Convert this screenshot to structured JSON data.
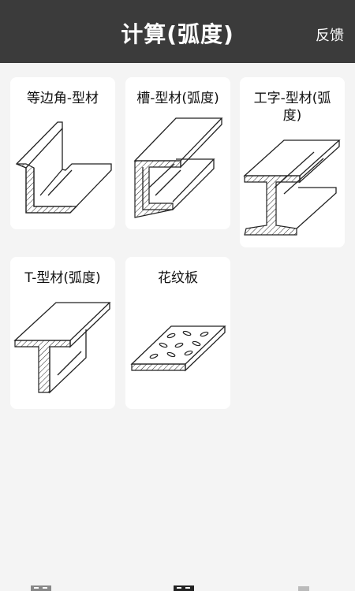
{
  "header": {
    "title": "计算(弧度)",
    "feedback": "反馈"
  },
  "cards": [
    {
      "label": "等边角-型材",
      "icon": "angle-steel-icon"
    },
    {
      "label": "槽-型材(弧度)",
      "icon": "channel-steel-icon"
    },
    {
      "label": "工字-型材(弧度)",
      "icon": "i-beam-icon"
    },
    {
      "label": "T-型材(弧度)",
      "icon": "t-bar-icon"
    },
    {
      "label": "花纹板",
      "icon": "checkered-plate-icon"
    }
  ],
  "tabbar": {
    "icons": [
      "calculator-icon",
      "calculator-icon",
      "profile-icon"
    ]
  }
}
